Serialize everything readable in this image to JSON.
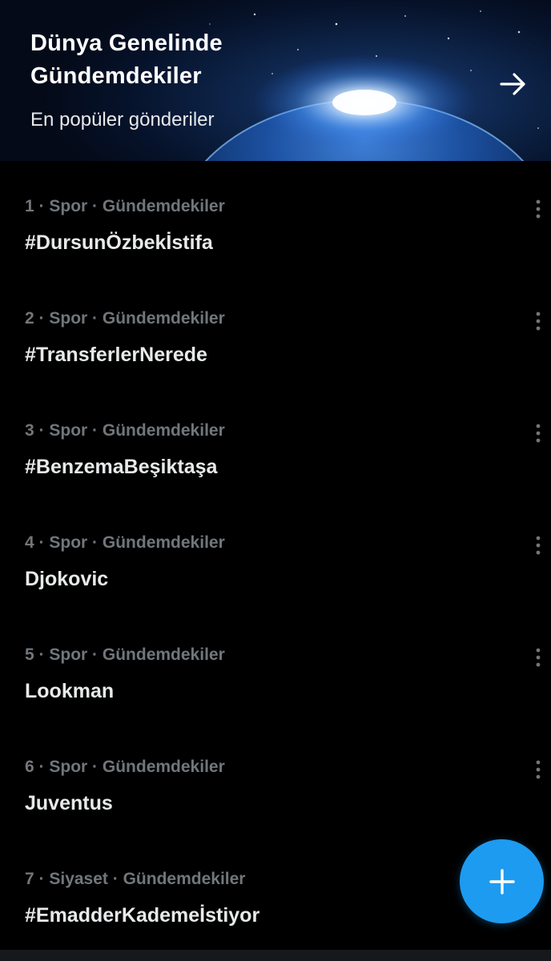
{
  "banner": {
    "title": "Dünya Genelinde Gündemdekiler",
    "subtitle": "En popüler gönderiler",
    "arrow_icon": "arrow-right-icon"
  },
  "trends": [
    {
      "rank": "1",
      "category": "Spor",
      "label": "Gündemdekiler",
      "name": "#DursunÖzbekİstifa"
    },
    {
      "rank": "2",
      "category": "Spor",
      "label": "Gündemdekiler",
      "name": "#TransferlerNerede"
    },
    {
      "rank": "3",
      "category": "Spor",
      "label": "Gündemdekiler",
      "name": "#BenzemaBeşiktaşa"
    },
    {
      "rank": "4",
      "category": "Spor",
      "label": "Gündemdekiler",
      "name": "Djokovic"
    },
    {
      "rank": "5",
      "category": "Spor",
      "label": "Gündemdekiler",
      "name": "Lookman"
    },
    {
      "rank": "6",
      "category": "Spor",
      "label": "Gündemdekiler",
      "name": "Juventus"
    },
    {
      "rank": "7",
      "category": "Siyaset",
      "label": "Gündemdekiler",
      "name": "#EmadderKademeİstiyor"
    }
  ],
  "fab": {
    "icon": "plus-icon"
  },
  "colors": {
    "accent": "#1d9bf0",
    "background": "#000000",
    "muted": "#71767b",
    "text": "#e7e9ea"
  }
}
